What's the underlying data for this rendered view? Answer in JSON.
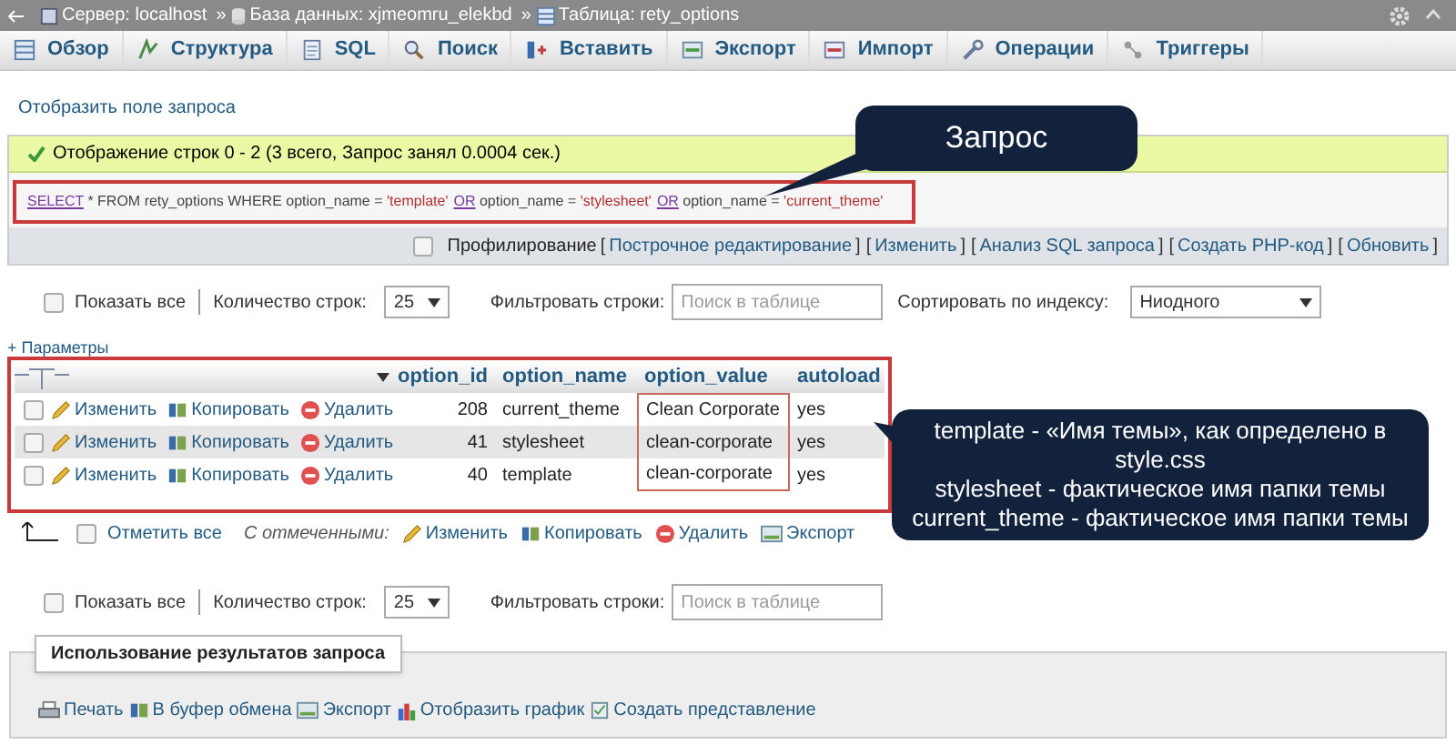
{
  "breadcrumb": [
    {
      "label": "Сервер: localhost",
      "kind": "server"
    },
    {
      "label": "База данных: xjmeomru_elekbd",
      "kind": "database"
    },
    {
      "label": "Таблица: rety_options",
      "kind": "table"
    }
  ],
  "breadcrumb_separators": [
    "»",
    "»"
  ],
  "tabs": [
    {
      "label": "Обзор",
      "selected": false
    },
    {
      "label": "Структура",
      "selected": false
    },
    {
      "label": "SQL",
      "selected": false
    },
    {
      "label": "Поиск",
      "selected": false
    },
    {
      "label": "Вставить",
      "selected": false
    },
    {
      "label": "Экспорт",
      "selected": false
    },
    {
      "label": "Импорт",
      "selected": false
    },
    {
      "label": "Операции",
      "selected": false
    },
    {
      "label": "Триггеры",
      "selected": false
    }
  ],
  "show_query_link": "Отобразить поле запроса",
  "success_message": "Отображение строк 0 - 2 (3 всего, Запрос занял 0.0004 сек.)",
  "sql_query": [
    {
      "text": "SELECT",
      "kind": "keyword"
    },
    {
      "text": " * FROM rety_options WHERE option_name = ",
      "kind": "plain"
    },
    {
      "text": "'template'",
      "kind": "string"
    },
    {
      "text": "OR",
      "kind": "keyword"
    },
    {
      "text": " option_name = ",
      "kind": "plain"
    },
    {
      "text": "'stylesheet'",
      "kind": "string"
    },
    {
      "text": "OR",
      "kind": "keyword"
    },
    {
      "text": " option_name = ",
      "kind": "plain"
    },
    {
      "text": "'current_theme'",
      "kind": "string"
    }
  ],
  "profiling": {
    "label": "Профилирование",
    "checked": false,
    "links": [
      {
        "open": "[",
        "label": "Построчное редактирование",
        "close": "]"
      },
      {
        "open": "[",
        "label": "Изменить",
        "close": "]"
      },
      {
        "open": "[",
        "label": "Анализ SQL запроса",
        "close": "]"
      },
      {
        "open": "[",
        "label": "Создать PHP-код",
        "close": "]"
      },
      {
        "open": "[",
        "label": "Обновить",
        "close": "]"
      }
    ]
  },
  "filter_rows": [
    {
      "show_all": "Показать все",
      "show_all_checked": false,
      "rows_label": "Количество строк:",
      "rows_value": "25",
      "filter_label": "Фильтровать строки:",
      "search_placeholder": "Поиск в таблице",
      "sort_label": "Сортировать по индексу:",
      "sort_value": "Ниодного"
    },
    {
      "show_all": "Показать все",
      "show_all_checked": false,
      "rows_label": "Количество строк:",
      "rows_value": "25",
      "filter_label": "Фильтровать строки:",
      "search_placeholder": "Поиск в таблице"
    }
  ],
  "options_link": "+ Параметры",
  "table": {
    "columns": [
      "option_id",
      "option_name",
      "option_value",
      "autoload"
    ],
    "rows": [
      {
        "checked": false,
        "actions": [
          {
            "label": "Изменить",
            "kind": "edit"
          },
          {
            "label": "Копировать",
            "kind": "copy"
          },
          {
            "label": "Удалить",
            "kind": "delete"
          }
        ],
        "cells": [
          "208",
          "current_theme",
          "Clean Corporate",
          "yes"
        ]
      },
      {
        "checked": false,
        "actions": [
          {
            "label": "Изменить",
            "kind": "edit"
          },
          {
            "label": "Копировать",
            "kind": "copy"
          },
          {
            "label": "Удалить",
            "kind": "delete"
          }
        ],
        "cells": [
          "41",
          "stylesheet",
          "clean-corporate",
          "yes"
        ]
      },
      {
        "checked": false,
        "actions": [
          {
            "label": "Изменить",
            "kind": "edit"
          },
          {
            "label": "Копировать",
            "kind": "copy"
          },
          {
            "label": "Удалить",
            "kind": "delete"
          }
        ],
        "cells": [
          "40",
          "template",
          "clean-corporate",
          "yes"
        ]
      }
    ]
  },
  "bulk": {
    "check_all": "Отметить все",
    "checked": false,
    "with_selected": "С отмеченными:",
    "actions": [
      {
        "label": "Изменить",
        "kind": "edit"
      },
      {
        "label": "Копировать",
        "kind": "copy"
      },
      {
        "label": "Удалить",
        "kind": "delete"
      },
      {
        "label": "Экспорт",
        "kind": "export"
      }
    ]
  },
  "query_results": {
    "legend": "Использование результатов запроса",
    "actions": [
      {
        "label": "Печать",
        "kind": "print"
      },
      {
        "label": "В буфер обмена",
        "kind": "copy"
      },
      {
        "label": "Экспорт",
        "kind": "export"
      },
      {
        "label": "Отобразить график",
        "kind": "chart"
      },
      {
        "label": "Создать представление",
        "kind": "view"
      }
    ]
  },
  "callouts": [
    {
      "kind": "small",
      "lines": [
        "Запрос"
      ]
    },
    {
      "kind": "large",
      "lines": [
        "template - «Имя темы», как определено в style.css",
        "stylesheet - фактическое имя папки темы",
        "current_theme - фактическое имя папки темы"
      ]
    }
  ]
}
